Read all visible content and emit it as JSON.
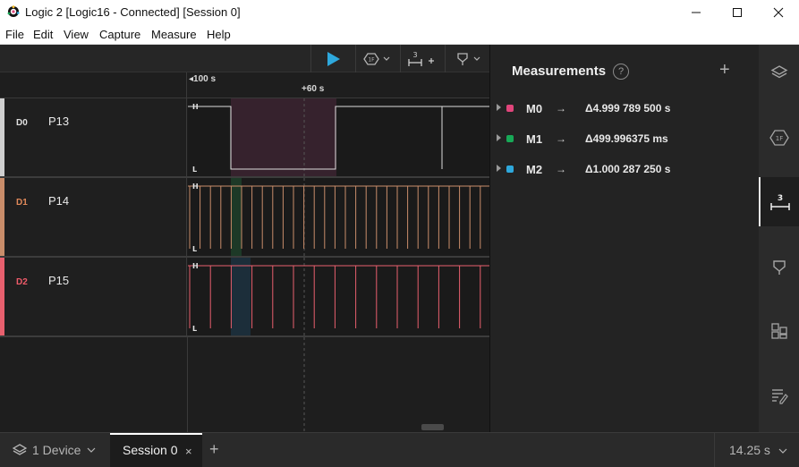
{
  "window": {
    "title": "Logic 2 [Logic16 - Connected] [Session 0]"
  },
  "menu": {
    "items": [
      "File",
      "Edit",
      "View",
      "Capture",
      "Measure",
      "Help"
    ]
  },
  "toolbar": {
    "measure_badge": "3"
  },
  "ruler": {
    "start_label": "100 s",
    "marker_label": "+60 s"
  },
  "channels": [
    {
      "index": "D0",
      "name": "P13",
      "color": "#cfcfcf",
      "index_color": "#e0e0e0",
      "high": "H",
      "low": "L"
    },
    {
      "index": "D1",
      "name": "P14",
      "color": "#c98d6a",
      "index_color": "#e0895a",
      "high": "H",
      "low": "L"
    },
    {
      "index": "D2",
      "name": "P15",
      "color": "#e8606e",
      "index_color": "#ef5b6a",
      "high": "H",
      "low": "L"
    }
  ],
  "panel": {
    "title": "Measurements",
    "help": "?",
    "add": "+",
    "measurements": [
      {
        "name": "M0",
        "arrow": "→",
        "value": "Δ4.999 789 500 s",
        "color": "#e0457b"
      },
      {
        "name": "M1",
        "arrow": "→",
        "value": "Δ499.996375 ms",
        "color": "#18a957"
      },
      {
        "name": "M2",
        "arrow": "→",
        "value": "Δ1.000 287 250 s",
        "color": "#2ea8dc"
      }
    ]
  },
  "sidebar": {
    "measure_badge": "3"
  },
  "bottom": {
    "device_label": "1 Device",
    "session_label": "Session 0",
    "close": "×",
    "add_tab": "+",
    "zoom_label": "14.25 s"
  }
}
